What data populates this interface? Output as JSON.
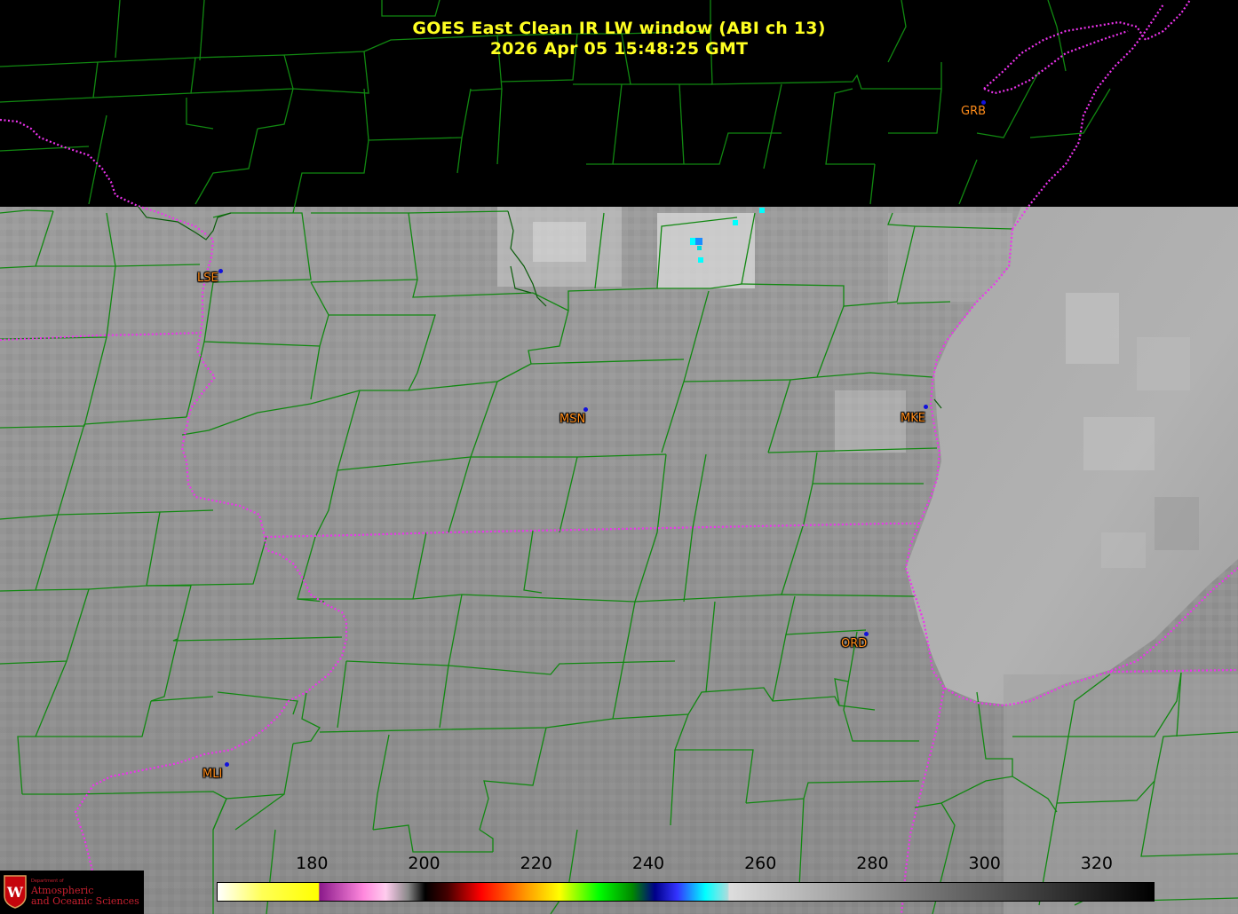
{
  "header": {
    "title_line1": "GOES East Clean IR LW window (ABI ch 13)",
    "title_line2": "2026 Apr 05  15:48:25 GMT"
  },
  "cities": [
    {
      "code": "GRB"
    },
    {
      "code": "LSE"
    },
    {
      "code": "MSN"
    },
    {
      "code": "MKE"
    },
    {
      "code": "ORD"
    },
    {
      "code": "MLI"
    }
  ],
  "colorbar": {
    "min": 163,
    "max": 330,
    "ticks": [
      "180",
      "200",
      "220",
      "240",
      "260",
      "280",
      "300",
      "320"
    ],
    "stops": [
      {
        "t": 163,
        "c": "#ffffff"
      },
      {
        "t": 171,
        "c": "#ffff55"
      },
      {
        "t": 181,
        "c": "#ffff00"
      },
      {
        "t": 181.2,
        "c": "#8b1a8b"
      },
      {
        "t": 189,
        "c": "#ff88dd"
      },
      {
        "t": 193,
        "c": "#ffccee"
      },
      {
        "t": 197,
        "c": "#888888"
      },
      {
        "t": 200,
        "c": "#000000"
      },
      {
        "t": 204,
        "c": "#440000"
      },
      {
        "t": 210,
        "c": "#ff0000"
      },
      {
        "t": 218,
        "c": "#ff9900"
      },
      {
        "t": 224,
        "c": "#ffff00"
      },
      {
        "t": 231,
        "c": "#00ff00"
      },
      {
        "t": 237,
        "c": "#008800"
      },
      {
        "t": 241,
        "c": "#000088"
      },
      {
        "t": 245,
        "c": "#3333ff"
      },
      {
        "t": 250,
        "c": "#00ffff"
      },
      {
        "t": 254,
        "c": "#aadddd"
      },
      {
        "t": 254.3,
        "c": "#dddddd"
      },
      {
        "t": 330,
        "c": "#000000"
      }
    ]
  },
  "colors": {
    "county_lines": "#118811",
    "state_lines": "#ee33ee",
    "title": "#ffff22",
    "city_label": "#ff8c1a",
    "city_dot": "#1111dd"
  },
  "logo": {
    "dept": "Department of",
    "line1": "Atmospheric",
    "line2": "and Oceanic Sciences"
  }
}
